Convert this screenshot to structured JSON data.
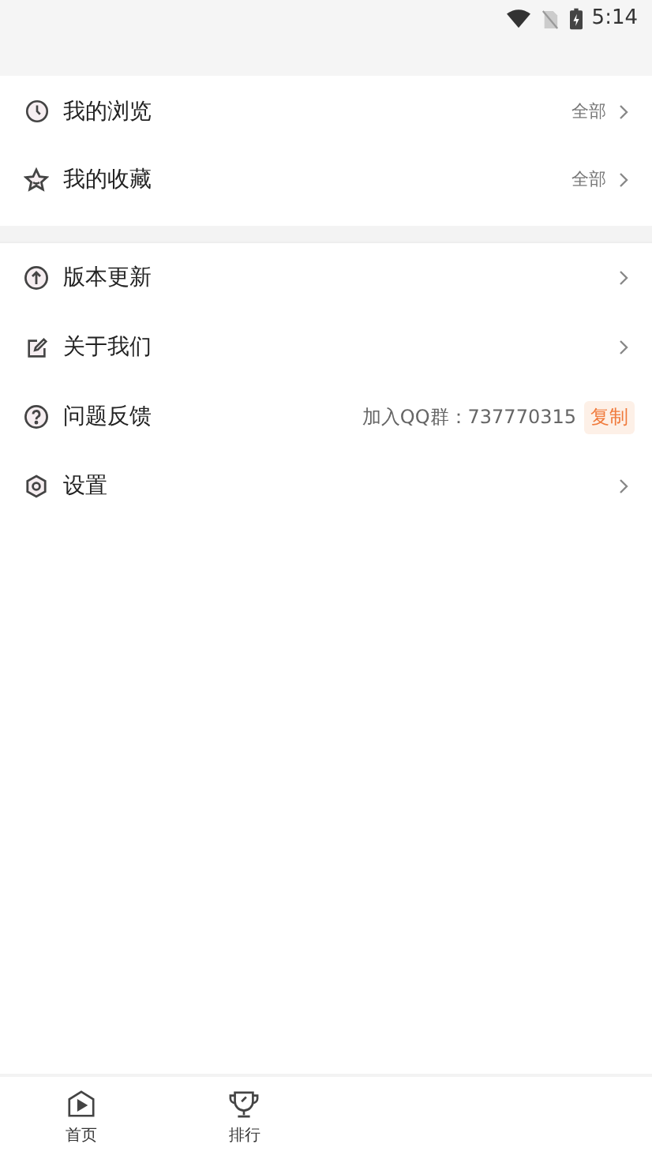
{
  "status_bar": {
    "time": "5:14"
  },
  "groups": [
    {
      "items": [
        {
          "kind": "link",
          "label": "我的浏览",
          "action": "全部"
        },
        {
          "kind": "link",
          "label": "我的收藏",
          "action": "全部"
        }
      ]
    },
    {
      "items": [
        {
          "kind": "link",
          "label": "版本更新"
        },
        {
          "kind": "link",
          "label": "关于我们"
        },
        {
          "kind": "contact",
          "label": "问题反馈",
          "info": "加入QQ群：737770315",
          "button": "复制"
        },
        {
          "kind": "link",
          "label": "设置"
        }
      ]
    }
  ],
  "bottom_nav": [
    {
      "label": "首页"
    },
    {
      "label": "排行"
    }
  ]
}
